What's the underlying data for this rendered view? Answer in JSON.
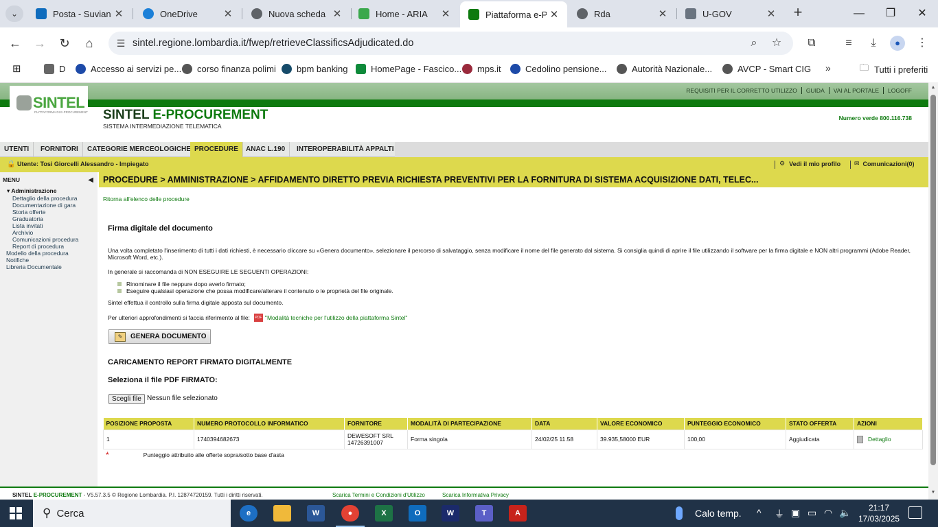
{
  "browser": {
    "tabs": [
      {
        "label": "Posta - Suviana /",
        "color": "#0f6cbd",
        "active": false
      },
      {
        "label": "OneDrive",
        "color": "#1c80d8",
        "active": false
      },
      {
        "label": "Nuova scheda",
        "color": "#5f6368",
        "active": false
      },
      {
        "label": "Home - ARIA",
        "color": "#3aa84c",
        "active": false
      },
      {
        "label": "Piattaforma e-Pr",
        "color": "#0e7a0f",
        "active": true
      },
      {
        "label": "Rda",
        "color": "#5f6368",
        "active": false
      },
      {
        "label": "U-GOV",
        "color": "#6a7480",
        "active": false
      }
    ],
    "url": "sintel.regione.lombardia.it/fwep/retrieveClassificsAdjudicated.do",
    "bookmarks": [
      {
        "label": "D",
        "color": "#666"
      },
      {
        "label": "Accesso ai servizi pe...",
        "color": "#1d4aa8"
      },
      {
        "label": "corso finanza polimi",
        "color": "#555"
      },
      {
        "label": "bpm banking",
        "color": "#164b6a"
      },
      {
        "label": "HomePage - Fascico...",
        "color": "#0e8a3a"
      },
      {
        "label": "mps.it",
        "color": "#9a2a3c"
      },
      {
        "label": "Cedolino pensione...",
        "color": "#1d4aa8"
      },
      {
        "label": "Autorità Nazionale...",
        "color": "#555"
      },
      {
        "label": "AVCP - Smart CIG",
        "color": "#555"
      }
    ],
    "all_bookmarks": "Tutti i preferiti"
  },
  "sintel": {
    "top_menu": [
      "REQUISITI PER IL CORRETTO UTILIZZO",
      "GUIDA",
      "VAI AL PORTALE",
      "LOGOFF"
    ],
    "logo_text": "SINTEL",
    "logo_sub": "PIATTAFORMA DI E-PROCUREMENT",
    "title_a": "SINTEL",
    "title_b": "E-PROCUREMENT",
    "subtitle": "SISTEMA INTERMEDIAZIONE TELEMATICA",
    "numero_verde": "Numero verde 800.116.738",
    "nav": [
      "UTENTI",
      "FORNITORI",
      "CATEGORIE MERCEOLOGICHE",
      "PROCEDURE",
      "ANAC L.190",
      "INTEROPERABILITÀ APPALTI"
    ],
    "user": "Utente: Tosi Giorcelli Alessandro - Impiegato",
    "profile_link": "Vedi il mio profilo",
    "comm_link": "Comunicazioni(0)",
    "menu_header": "MENU",
    "menu": {
      "group": "Administrazione",
      "items": [
        "Dettaglio della procedura",
        "Documentazione di gara",
        "Storia offerte",
        "Graduatoria",
        "Lista invitati",
        "Archivio",
        "Comunicazioni procedura",
        "Report di procedura"
      ],
      "top_items": [
        "Modello della procedura",
        "Notifiche",
        "Libreria Documentale"
      ]
    },
    "breadcrumb": "PROCEDURE   > AMMINISTRAZIONE   > AFFIDAMENTO DIRETTO PREVIA RICHIESTA PREVENTIVI PER LA FORNITURA DI SISTEMA ACQUISIZIONE DATI, TELEC...",
    "back_link": "Ritorna all'elenco delle procedure",
    "section_title": "Firma digitale del documento",
    "intro": "Una volta completato l'inserimento di tutti i dati richiesti, è necessario cliccare su «Genera documento», selezionare il percorso di salvataggio, senza modificare il nome del file generato dal sistema. Si consiglia quindi di aprire il file utilizzando il software per la firma digitale e NON altri programmi (Adobe Reader, Microsoft Word, etc.).",
    "warning": "In generale si raccomanda di NON ESEGUIRE LE SEGUENTI OPERAZIONI:",
    "bullets": [
      "Rinominare il file neppure dopo averlo firmato;",
      "Eseguire qualsiasi operazione che possa modificare/alterare il contenuto o le proprietà del file originale."
    ],
    "check": "Sintel effettua il controllo sulla firma digitale apposta sul documento.",
    "ref": "Per ulteriori approfondimenti si faccia riferimento al file:",
    "ref_link": "\"Modalità tecniche per l'utilizzo della piattaforma Sintel\"",
    "pdf_label": "PDF",
    "genera_btn": "GENERA DOCUMENTO",
    "upload_title": "CARICAMENTO REPORT FIRMATO DIGITALMENTE",
    "file_label": "Seleziona il file PDF FIRMATO:",
    "file_btn": "Scegli file",
    "file_none": "Nessun file selezionato",
    "table": {
      "headers": [
        "POSIZIONE PROPOSTA",
        "NUMERO PROTOCOLLO INFORMATICO",
        "FORNITORE",
        "MODALITÀ DI PARTECIPAZIONE",
        "DATA",
        "VALORE ECONOMICO",
        "PUNTEGGIO ECONOMICO",
        "STATO OFFERTA",
        "AZIONI"
      ],
      "row": {
        "posizione": "1",
        "protocollo": "1740394682673",
        "fornitore_a": "DEWESOFT SRL",
        "fornitore_b": "14726391007",
        "modalita": "Forma singola",
        "data": "24/02/25 11.58",
        "valore": "39.935,58000   EUR",
        "punteggio": "100,00",
        "stato": "Aggiudicata",
        "azione": "Dettaglio"
      }
    },
    "footnote_star": "*",
    "footnote": "Punteggio attribuito alle offerte sopra/sotto base d'asta",
    "footer_brand_a": "SINTEL",
    "footer_brand_b": "E-PROCUREMENT",
    "footer_copy": "- V5.57.3.5 © Regione Lombardia. P.I. 12874720159. Tutti i diritti riservati.",
    "footer_terms": "Scarica Termini e Condizioni d'Utilizzo",
    "footer_privacy": "Scarica Informativa Privacy"
  },
  "taskbar": {
    "search": "Cerca",
    "weather": "Calo temp.",
    "time": "21:17",
    "date": "17/03/2025"
  }
}
